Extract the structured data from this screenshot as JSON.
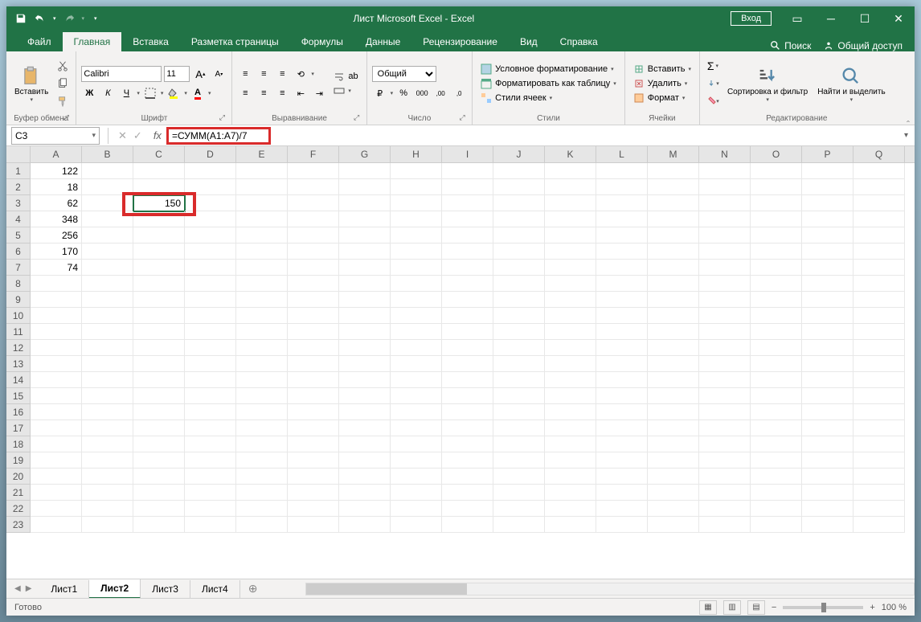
{
  "titlebar": {
    "title": "Лист Microsoft Excel - Excel",
    "login": "Вход"
  },
  "tabs": {
    "file": "Файл",
    "home": "Главная",
    "insert": "Вставка",
    "layout": "Разметка страницы",
    "formulas": "Формулы",
    "data": "Данные",
    "review": "Рецензирование",
    "view": "Вид",
    "help": "Справка",
    "search": "Поиск",
    "share": "Общий доступ"
  },
  "ribbon": {
    "clipboard": {
      "label": "Буфер обмена",
      "paste": "Вставить"
    },
    "font": {
      "label": "Шрифт",
      "name": "Calibri",
      "size": "11",
      "bold": "Ж",
      "italic": "К",
      "underline": "Ч"
    },
    "alignment": {
      "label": "Выравнивание"
    },
    "number": {
      "label": "Число",
      "format": "Общий"
    },
    "styles": {
      "label": "Стили",
      "conditional": "Условное форматирование",
      "table": "Форматировать как таблицу",
      "cellstyles": "Стили ячеек"
    },
    "cells": {
      "label": "Ячейки",
      "insert": "Вставить",
      "delete": "Удалить",
      "format": "Формат"
    },
    "editing": {
      "label": "Редактирование",
      "sort": "Сортировка и фильтр",
      "find": "Найти и выделить"
    }
  },
  "formula_bar": {
    "active_cell": "C3",
    "formula": "=СУММ(A1:A7)/7"
  },
  "columns": [
    "A",
    "B",
    "C",
    "D",
    "E",
    "F",
    "G",
    "H",
    "I",
    "J",
    "K",
    "L",
    "M",
    "N",
    "O",
    "P",
    "Q"
  ],
  "rows": [
    1,
    2,
    3,
    4,
    5,
    6,
    7,
    8,
    9,
    10,
    11,
    12,
    13,
    14,
    15,
    16,
    17,
    18,
    19,
    20,
    21,
    22,
    23
  ],
  "data_a": [
    "122",
    "18",
    "62",
    "348",
    "256",
    "170",
    "74"
  ],
  "c3_value": "150",
  "sheets": {
    "s1": "Лист1",
    "s2": "Лист2",
    "s3": "Лист3",
    "s4": "Лист4"
  },
  "status": {
    "ready": "Готово",
    "zoom": "100 %"
  }
}
